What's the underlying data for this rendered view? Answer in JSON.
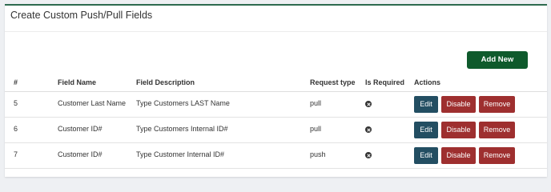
{
  "page": {
    "title": "Create Custom Push/Pull Fields"
  },
  "toolbar": {
    "add_new_label": "Add New"
  },
  "table": {
    "columns": [
      "#",
      "Field Name",
      "Field Description",
      "Request type",
      "Is Required",
      "Actions"
    ],
    "rows": [
      {
        "id": "5",
        "field_name": "Customer Last Name",
        "description": "Type Customers LAST Name",
        "request_type": "pull",
        "required_icon": "x-circle-icon"
      },
      {
        "id": "6",
        "field_name": "Customer ID#",
        "description": "Type Customers Internal ID#",
        "request_type": "pull",
        "required_icon": "x-circle-icon"
      },
      {
        "id": "7",
        "field_name": "Customer ID#",
        "description": "Type Customer Internal ID#",
        "request_type": "push",
        "required_icon": "x-circle-icon"
      }
    ],
    "actions": {
      "edit": "Edit",
      "disable": "Disable",
      "remove": "Remove"
    }
  },
  "colors": {
    "panel_accent": "#2e6b4f",
    "add_new": "#0f5a2c",
    "edit": "#234e62",
    "danger": "#9e2f2f"
  }
}
